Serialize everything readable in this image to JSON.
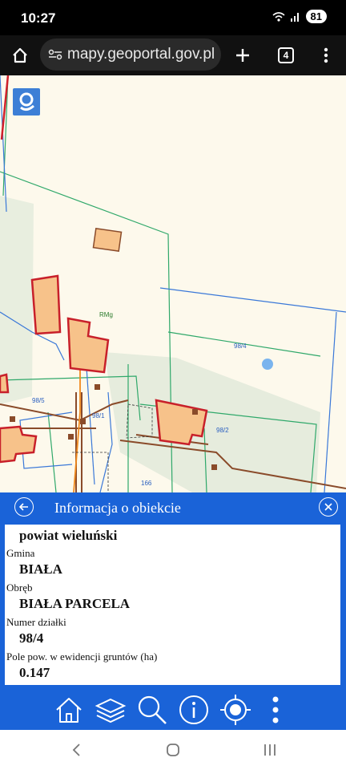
{
  "status": {
    "time": "10:27",
    "battery": "81"
  },
  "browser": {
    "url": "mapy.geoportal.gov.pl",
    "tab_count": "4"
  },
  "map": {
    "parcel_labels": [
      {
        "key": "98_4",
        "text": "98/4"
      },
      {
        "key": "98_5",
        "text": "98/5"
      },
      {
        "key": "98_2",
        "text": "98/2"
      },
      {
        "key": "98_1",
        "text": "98/1"
      },
      {
        "key": "166",
        "text": "166"
      },
      {
        "key": "rmg",
        "text": "RMg"
      }
    ]
  },
  "info_panel": {
    "title": "Informacja o obiekcie",
    "rows": [
      {
        "label": "",
        "value": "powiat wieluński"
      },
      {
        "label": "Gmina",
        "value": "BIAŁA"
      },
      {
        "label": "Obręb",
        "value": "BIAŁA PARCELA"
      },
      {
        "label": "Numer działki",
        "value": "98/4"
      },
      {
        "label": "Pole pow. w ewidencji gruntów (ha)",
        "value": "0.147"
      }
    ]
  },
  "toolbar": {
    "buttons": [
      "home-icon",
      "layers-icon",
      "search-icon",
      "info-icon",
      "locate-icon",
      "more-icon"
    ]
  },
  "colors": {
    "panel_blue": "#1a63d8",
    "building_fill": "#f7c28a",
    "building_border": "#c8202a",
    "parcel_line": "#2fa86a"
  }
}
